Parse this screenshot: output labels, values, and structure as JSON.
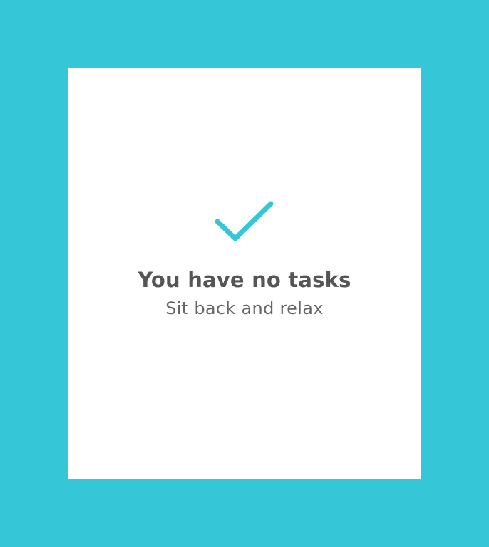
{
  "theme": {
    "background": "#35c7d8",
    "card_background": "#ffffff",
    "accent": "#35c7d8",
    "text_primary": "#555555",
    "text_secondary": "#666666"
  },
  "empty_state": {
    "icon": "checkmark-icon",
    "title": "You have no tasks",
    "subtitle": "Sit back and relax"
  }
}
